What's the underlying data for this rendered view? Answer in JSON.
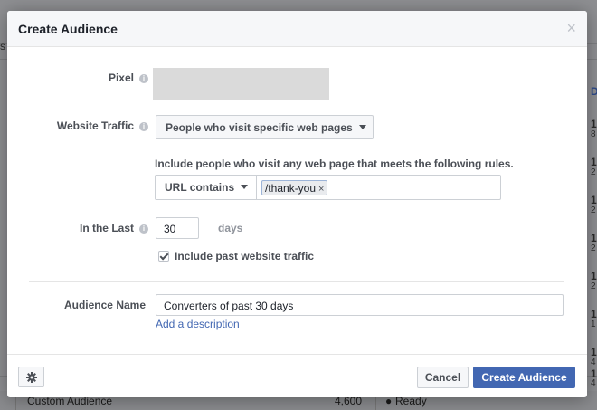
{
  "background": {
    "left_edge_text": "s",
    "right_header": "D",
    "right_numbers": [
      "1",
      "8",
      "1",
      "2",
      "1",
      "2",
      "1",
      "2",
      "1",
      "2",
      "1",
      "1",
      "1",
      "4",
      "1",
      "4",
      "1",
      "4"
    ],
    "bottom_row": {
      "type": "Custom Audience",
      "size": "4,600",
      "status": "Ready"
    }
  },
  "dialog": {
    "title": "Create Audience",
    "close": "×",
    "pixel": {
      "label": "Pixel"
    },
    "website_traffic": {
      "label": "Website Traffic",
      "selected": "People who visit specific web pages"
    },
    "rules_text": "Include people who visit any web page that meets the following rules.",
    "url_rule": {
      "operator": "URL contains",
      "tokens": [
        "/thank-you"
      ],
      "token_remove": "×"
    },
    "in_the_last": {
      "label": "In the Last",
      "value": "30",
      "unit": "days"
    },
    "include_past": {
      "label": "Include past website traffic",
      "checked": true
    },
    "audience_name": {
      "label": "Audience Name",
      "value": "Converters of past 30 days"
    },
    "add_description": "Add a description",
    "buttons": {
      "cancel": "Cancel",
      "create": "Create Audience"
    }
  },
  "colors": {
    "primary": "#4267b2",
    "text": "#1d2129",
    "muted_label": "#4b4f56"
  }
}
